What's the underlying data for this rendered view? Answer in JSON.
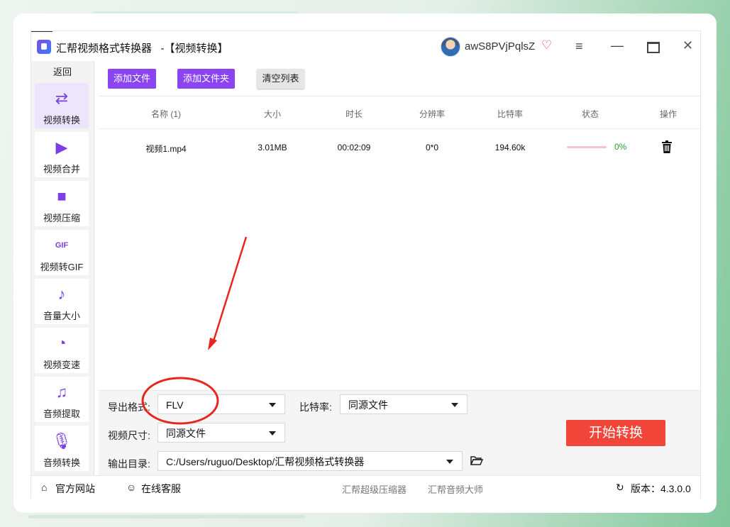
{
  "app": {
    "title": "汇帮视频格式转换器   -【视频转换】",
    "username": "awS8PVjPqlsZ"
  },
  "sidebar": {
    "back_label": "返回",
    "items": [
      {
        "label": "视频转换",
        "icon": "video-convert-icon",
        "glyph": "⇄",
        "active": true
      },
      {
        "label": "视频合并",
        "icon": "video-merge-icon",
        "glyph": "▶",
        "active": false
      },
      {
        "label": "视频压缩",
        "icon": "video-camera-icon",
        "glyph": "■",
        "active": false
      },
      {
        "label": "视频转GIF",
        "icon": "gif-icon",
        "glyph": "GIF",
        "active": false
      },
      {
        "label": "音量大小",
        "icon": "music-note-icon",
        "glyph": "♪",
        "active": false
      },
      {
        "label": "视频变速",
        "icon": "speedometer-icon",
        "glyph": "◔",
        "active": false
      },
      {
        "label": "音频提取",
        "icon": "music-notes-icon",
        "glyph": "♫",
        "active": false
      },
      {
        "label": "音频转换",
        "icon": "microphone-icon",
        "glyph": "🎙",
        "active": false
      }
    ]
  },
  "toolbar": {
    "add_file": "添加文件",
    "add_folder": "添加文件夹",
    "clear_list": "清空列表"
  },
  "table": {
    "headers": [
      "名称 (1)",
      "大小",
      "时长",
      "分辨率",
      "比特率",
      "状态",
      "操作"
    ],
    "rows": [
      {
        "name": "视频1.mp4",
        "size": "3.01MB",
        "duration": "00:02:09",
        "resolution": "0*0",
        "bitrate": "194.60k",
        "progress": 0,
        "progress_text": "0%"
      }
    ]
  },
  "settings": {
    "format_label": "导出格式:",
    "format_value": "FLV",
    "bitrate_label": "比特率:",
    "bitrate_value": "同源文件",
    "size_label": "视频尺寸:",
    "size_value": "同源文件",
    "output_label": "输出目录:",
    "output_value": "C:/Users/ruguo/Desktop/汇帮视频格式转换器",
    "start_button": "开始转换"
  },
  "footer": {
    "website": "官方网站",
    "support": "在线客服",
    "link1": "汇帮超级压缩器",
    "link2": "汇帮音频大师",
    "version": "版本：4.3.0.0"
  },
  "colors": {
    "accent": "#8b45f0",
    "start": "#f2453a",
    "annotation": "#e8261e",
    "progress_text": "#2aa32a"
  }
}
